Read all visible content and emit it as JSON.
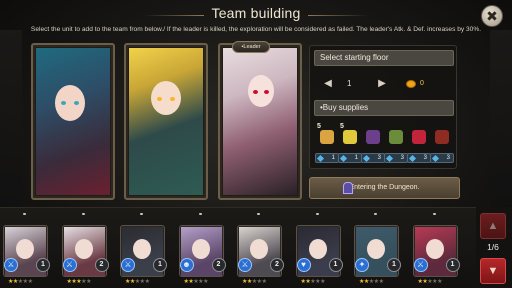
{
  "header": {
    "title": "Team building",
    "close_label": "✖",
    "instructions": "Select the unit to add to the team from below./ If the leader is killed, the exploration will be considered as failed. The leader's Atk. & Def. increases by 30%."
  },
  "team": {
    "leader_tag": "•Leader",
    "slots": [
      {
        "hair": "#2f8fa6",
        "accent": "#7b2332"
      },
      {
        "hair": "#f1d24a",
        "accent": "#2e5b52"
      },
      {
        "hair": "#e8dde0",
        "accent": "#8f5f72"
      }
    ]
  },
  "floor": {
    "label": "Select starting floor",
    "prev_arrow": "◀",
    "next_arrow": "▶",
    "value": "1",
    "cost": "0"
  },
  "supplies": {
    "label": "•Buy supplies",
    "items": [
      {
        "name": "bread",
        "count": "5",
        "price": "1",
        "color": "#d9a441"
      },
      {
        "name": "corn",
        "count": "5",
        "price": "1",
        "color": "#e0c93a"
      },
      {
        "name": "grapes",
        "count": "",
        "price": "3",
        "color": "#6b3f8c"
      },
      {
        "name": "herb",
        "count": "",
        "price": "3",
        "color": "#6b8c3a"
      },
      {
        "name": "potion",
        "count": "",
        "price": "3",
        "color": "#c2243a"
      },
      {
        "name": "meat",
        "count": "",
        "price": "3",
        "color": "#8e2b22"
      }
    ]
  },
  "enter_button": "Entering the Dungeon.",
  "roster": {
    "page": "1/6",
    "up_label": "▲",
    "down_label": "▼",
    "units": [
      {
        "level": "1",
        "type_icon": "sword-icon",
        "stars": 2,
        "hair": "#d8d3d8",
        "bg": "#5a4450"
      },
      {
        "level": "2",
        "type_icon": "sword-icon",
        "stars": 3,
        "hair": "#e6dfe3",
        "bg": "#6a3a44"
      },
      {
        "level": "1",
        "type_icon": "sword-icon",
        "stars": 2,
        "hair": "#2c2c30",
        "bg": "#3a3f4a"
      },
      {
        "level": "2",
        "type_icon": "mask-icon",
        "stars": 2,
        "hair": "#b4a0c8",
        "bg": "#5a4468"
      },
      {
        "level": "2",
        "type_icon": "sword-icon",
        "stars": 2,
        "hair": "#d9d4cf",
        "bg": "#4e4a52"
      },
      {
        "level": "1",
        "type_icon": "heart-icon",
        "stars": 2,
        "hair": "#2a2a33",
        "bg": "#3b3d4c"
      },
      {
        "level": "1",
        "type_icon": "gun-icon",
        "stars": 2,
        "hair": "#3f5a6a",
        "bg": "#35505c"
      },
      {
        "level": "1",
        "type_icon": "sword-icon",
        "stars": 2,
        "hair": "#b83a55",
        "bg": "#5c2a3c"
      }
    ]
  }
}
